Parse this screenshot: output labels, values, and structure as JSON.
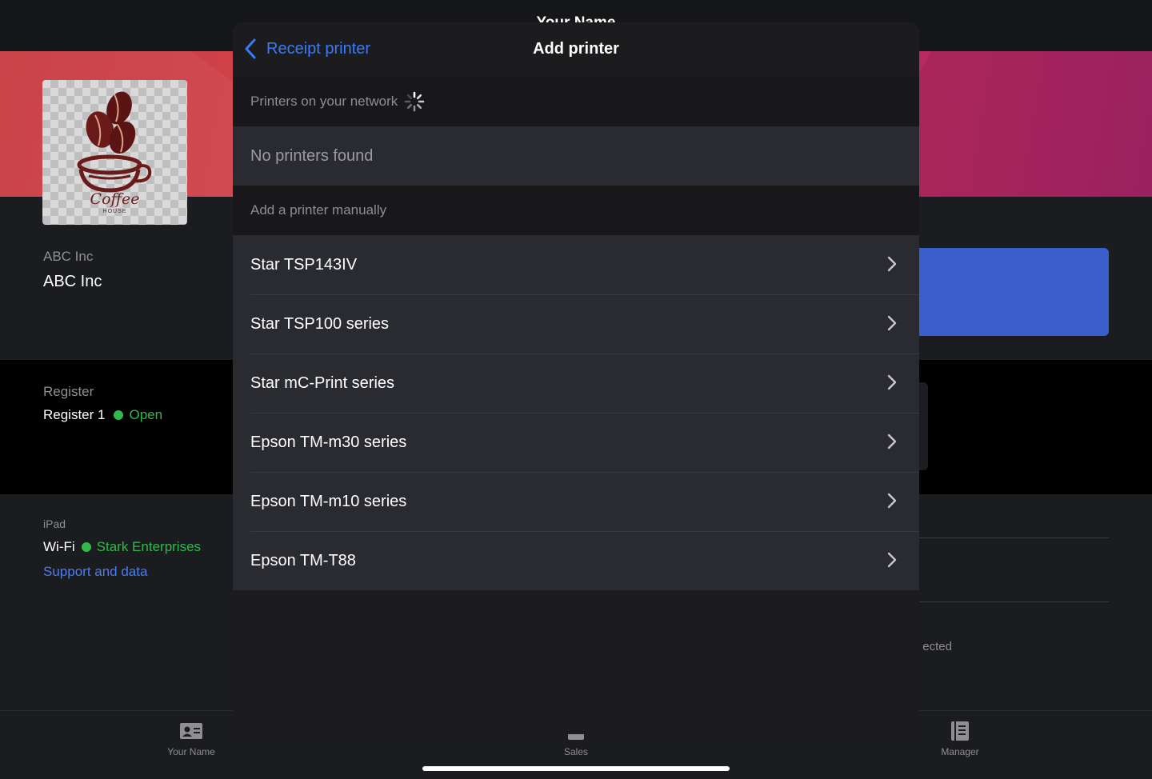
{
  "background": {
    "topbar_title": "Your Name",
    "business": {
      "label": "ABC Inc",
      "name": "ABC Inc"
    },
    "logo": {
      "word": "Coffee",
      "sub": "HOUSE"
    },
    "register": {
      "label": "Register",
      "name": "Register 1",
      "status": "Open"
    },
    "ipad": {
      "label": "iPad",
      "wifi_label": "Wi-Fi",
      "wifi_network": "Stark Enterprises",
      "support_link": "Support and data"
    },
    "right_partial_text": "ected"
  },
  "tabbar": {
    "tabs": [
      {
        "label": "Your Name",
        "icon": "contact-card-icon"
      },
      {
        "label": "Sales",
        "icon": "register-icon"
      },
      {
        "label": "Manager",
        "icon": "ledger-icon"
      }
    ]
  },
  "modal": {
    "back_label": "Receipt printer",
    "title": "Add printer",
    "network_header": "Printers on your network",
    "empty_text": "No printers found",
    "manual_header": "Add a printer manually",
    "printers": [
      "Star TSP143IV",
      "Star TSP100 series",
      "Star mC-Print series",
      "Epson TM-m30 series",
      "Epson TM-m10 series",
      "Epson TM-T88"
    ]
  },
  "colors": {
    "accent_blue": "#3a7bf5",
    "status_green": "#30b94a",
    "banner_red": "#c8393f",
    "banner_magenta": "#a72468"
  }
}
